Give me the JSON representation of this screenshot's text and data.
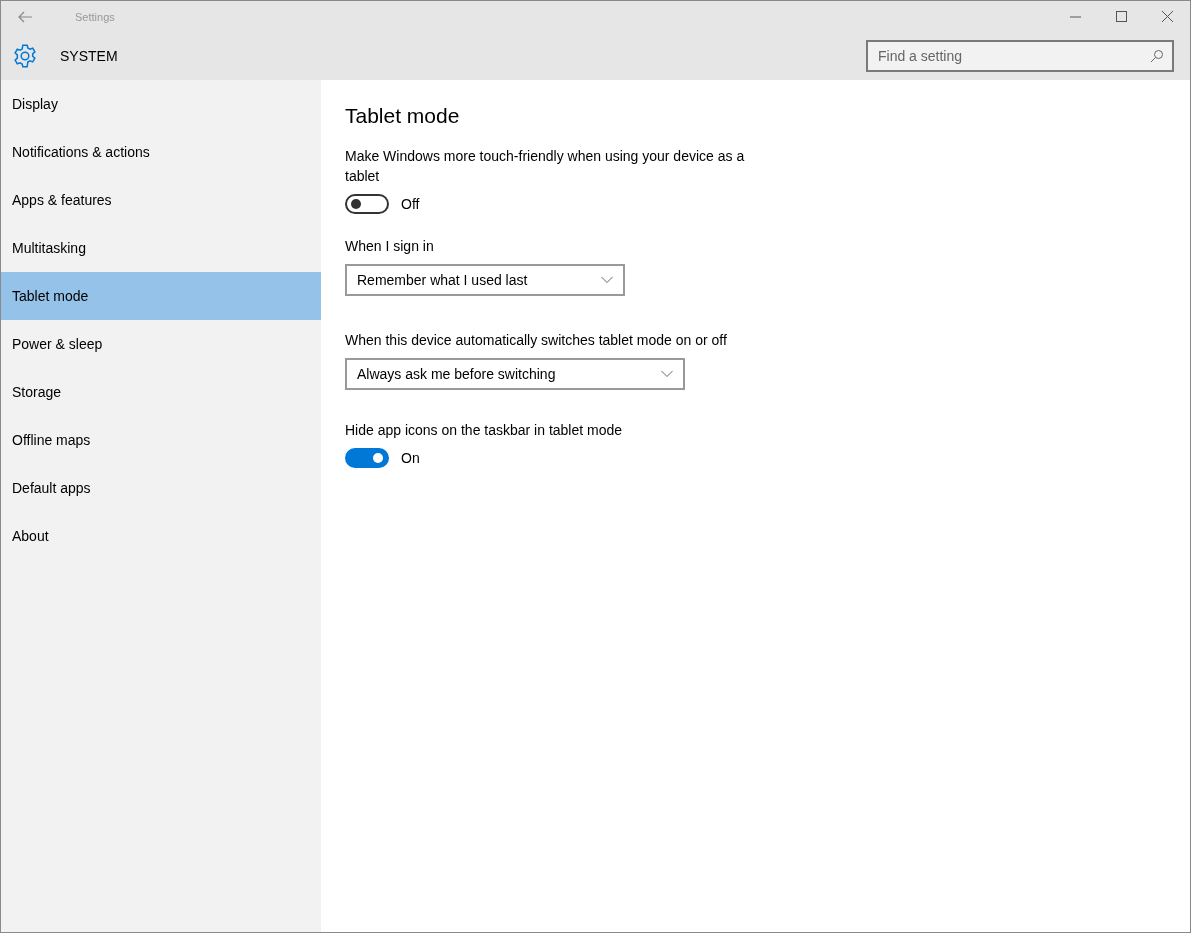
{
  "window": {
    "title": "Settings"
  },
  "header": {
    "section": "SYSTEM",
    "search": {
      "placeholder": "Find a setting"
    }
  },
  "sidebar": {
    "items": [
      {
        "label": "Display",
        "selected": false
      },
      {
        "label": "Notifications & actions",
        "selected": false
      },
      {
        "label": "Apps & features",
        "selected": false
      },
      {
        "label": "Multitasking",
        "selected": false
      },
      {
        "label": "Tablet mode",
        "selected": true
      },
      {
        "label": "Power & sleep",
        "selected": false
      },
      {
        "label": "Storage",
        "selected": false
      },
      {
        "label": "Offline maps",
        "selected": false
      },
      {
        "label": "Default apps",
        "selected": false
      },
      {
        "label": "About",
        "selected": false
      }
    ]
  },
  "page": {
    "title": "Tablet mode",
    "settings": [
      {
        "kind": "toggle",
        "label": "Make Windows more touch-friendly when using your device as a tablet",
        "on": false,
        "state_label": "Off"
      },
      {
        "kind": "dropdown",
        "label": "When I sign in",
        "value": "Remember what I used last"
      },
      {
        "kind": "dropdown",
        "label": "When this device automatically switches tablet mode on or off",
        "value": "Always ask me before switching"
      },
      {
        "kind": "toggle",
        "label": "Hide app icons on the taskbar in tablet mode",
        "on": true,
        "state_label": "On"
      }
    ]
  }
}
